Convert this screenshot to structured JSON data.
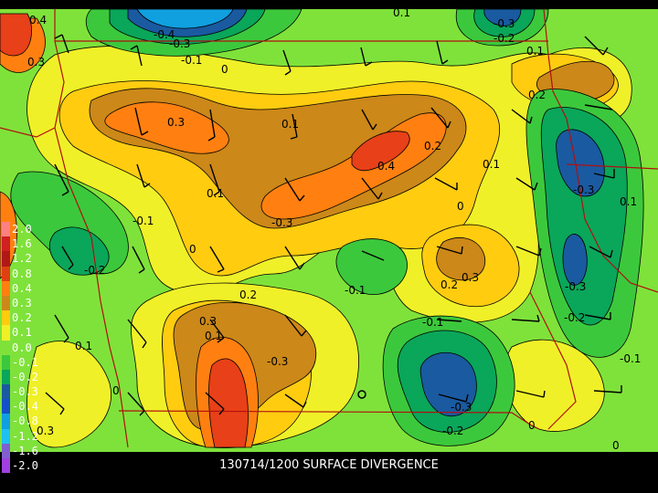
{
  "title": "130714/1200 SURFACE DIVERGENCE",
  "colors": {
    "very_low": "#1a5aa0",
    "low_strong": "#0aa65a",
    "low": "#3cc83c",
    "low_mid": "#7fe23a",
    "near_zero": "#f0f028",
    "pos_low": "#ffcc10",
    "pos_mid": "#cc8818",
    "pos_high": "#ff8010",
    "pos_max": "#e84018",
    "boundary": "#b01010",
    "contour": "#000000"
  },
  "legend": [
    {
      "label": "2.0",
      "color": "#ff8080"
    },
    {
      "label": "1.6",
      "color": "#d02020"
    },
    {
      "label": "1.2",
      "color": "#b01818"
    },
    {
      "label": "0.8",
      "color": "#e04010"
    },
    {
      "label": "0.4",
      "color": "#ff8010"
    },
    {
      "label": "0.3",
      "color": "#cc8818"
    },
    {
      "label": "0.2",
      "color": "#ffcc10"
    },
    {
      "label": "0.1",
      "color": "#f0f028"
    },
    {
      "label": "0.0",
      "color": "#7fe23a"
    },
    {
      "label": "-0.1",
      "color": "#3cc83c"
    },
    {
      "label": "-0.2",
      "color": "#0aa65a"
    },
    {
      "label": "-0.3",
      "color": "#1a5aa0"
    },
    {
      "label": "-0.4",
      "color": "#1450c8"
    },
    {
      "label": "-0.8",
      "color": "#10a0e0"
    },
    {
      "label": "-1.2",
      "color": "#20c0f0"
    },
    {
      "label": "-1.6",
      "color": "#8060d0"
    },
    {
      "label": "-2.0",
      "color": "#a040e0"
    }
  ],
  "contour_labels": [
    {
      "text": "0.4"
    },
    {
      "text": "0.3"
    },
    {
      "text": "-0.4"
    },
    {
      "text": "-0.3"
    },
    {
      "text": "-0.1"
    },
    {
      "text": "0"
    },
    {
      "text": "0.1"
    },
    {
      "text": "-0.3"
    },
    {
      "text": "-0.2"
    },
    {
      "text": "0.1"
    },
    {
      "text": "0.2"
    },
    {
      "text": "0.3"
    },
    {
      "text": "0.1"
    },
    {
      "text": "0.4"
    },
    {
      "text": "0.2"
    },
    {
      "text": "0.1"
    },
    {
      "text": "-0.3"
    },
    {
      "text": "0.1"
    },
    {
      "text": "0.1"
    },
    {
      "text": "-0.1"
    },
    {
      "text": "0"
    },
    {
      "text": "-0.3"
    },
    {
      "text": "0"
    },
    {
      "text": "-0.2"
    },
    {
      "text": "0.3"
    },
    {
      "text": "0.2"
    },
    {
      "text": "-0.1"
    },
    {
      "text": "-0.3"
    },
    {
      "text": "0.2"
    },
    {
      "text": "0.3"
    },
    {
      "text": "0.1"
    },
    {
      "text": "-0.1"
    },
    {
      "text": "-0.2"
    },
    {
      "text": "0.1"
    },
    {
      "text": "-0.1"
    },
    {
      "text": "0"
    },
    {
      "text": "-0.3"
    },
    {
      "text": "-0.2"
    },
    {
      "text": "0"
    },
    {
      "text": "0"
    },
    {
      "text": "-0.3"
    },
    {
      "text": "0.3"
    }
  ]
}
